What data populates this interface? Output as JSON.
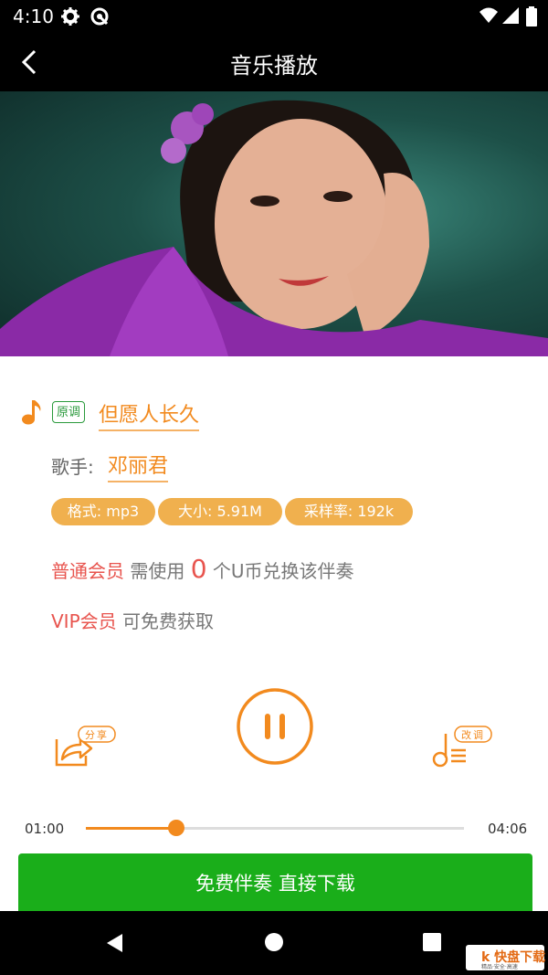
{
  "status_bar": {
    "time": "4:10",
    "icons": [
      "gear-icon",
      "at-icon",
      "wifi-icon",
      "signal-icon",
      "battery-icon"
    ]
  },
  "header": {
    "title": "音乐播放"
  },
  "song": {
    "tag": "原调",
    "title": "但愿人长久",
    "singer_label": "歌手:",
    "singer": "邓丽君",
    "tags": [
      "格式: mp3",
      "大小: 5.91M",
      "采样率: 192k"
    ]
  },
  "membership": {
    "normal_label": "普通会员",
    "normal_pre": " 需使用 ",
    "normal_cost": "0",
    "normal_post": " 个U币兑换该伴奏",
    "vip_label": "VIP会员",
    "vip_text": " 可免费获取"
  },
  "controls": {
    "share_label": "分享",
    "tune_label": "改调",
    "state": "playing"
  },
  "progress": {
    "current": "01:00",
    "total": "04:06",
    "fraction": 0.24
  },
  "download_button": "免费伴奏 直接下载",
  "watermark": {
    "text": "k 快盘下载",
    "sub": "精品·安全·高速"
  },
  "colors": {
    "accent": "#f28a1e",
    "green": "#1aae1a",
    "red": "#e8544e",
    "tag_bg": "#f0b04e"
  }
}
